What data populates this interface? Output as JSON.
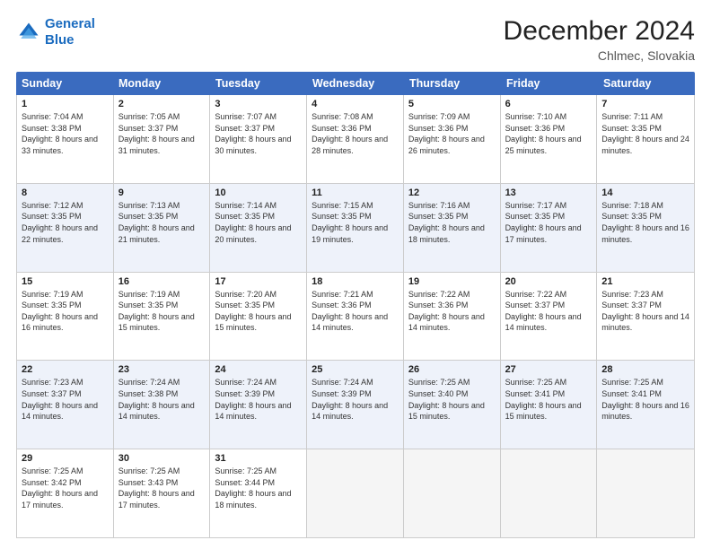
{
  "logo": {
    "line1": "General",
    "line2": "Blue"
  },
  "title": "December 2024",
  "location": "Chlmec, Slovakia",
  "header": {
    "days": [
      "Sunday",
      "Monday",
      "Tuesday",
      "Wednesday",
      "Thursday",
      "Friday",
      "Saturday"
    ]
  },
  "rows": [
    [
      {
        "day": "1",
        "sunrise": "7:04 AM",
        "sunset": "3:38 PM",
        "daylight": "8 hours and 33 minutes."
      },
      {
        "day": "2",
        "sunrise": "7:05 AM",
        "sunset": "3:37 PM",
        "daylight": "8 hours and 31 minutes."
      },
      {
        "day": "3",
        "sunrise": "7:07 AM",
        "sunset": "3:37 PM",
        "daylight": "8 hours and 30 minutes."
      },
      {
        "day": "4",
        "sunrise": "7:08 AM",
        "sunset": "3:36 PM",
        "daylight": "8 hours and 28 minutes."
      },
      {
        "day": "5",
        "sunrise": "7:09 AM",
        "sunset": "3:36 PM",
        "daylight": "8 hours and 26 minutes."
      },
      {
        "day": "6",
        "sunrise": "7:10 AM",
        "sunset": "3:36 PM",
        "daylight": "8 hours and 25 minutes."
      },
      {
        "day": "7",
        "sunrise": "7:11 AM",
        "sunset": "3:35 PM",
        "daylight": "8 hours and 24 minutes."
      }
    ],
    [
      {
        "day": "8",
        "sunrise": "7:12 AM",
        "sunset": "3:35 PM",
        "daylight": "8 hours and 22 minutes."
      },
      {
        "day": "9",
        "sunrise": "7:13 AM",
        "sunset": "3:35 PM",
        "daylight": "8 hours and 21 minutes."
      },
      {
        "day": "10",
        "sunrise": "7:14 AM",
        "sunset": "3:35 PM",
        "daylight": "8 hours and 20 minutes."
      },
      {
        "day": "11",
        "sunrise": "7:15 AM",
        "sunset": "3:35 PM",
        "daylight": "8 hours and 19 minutes."
      },
      {
        "day": "12",
        "sunrise": "7:16 AM",
        "sunset": "3:35 PM",
        "daylight": "8 hours and 18 minutes."
      },
      {
        "day": "13",
        "sunrise": "7:17 AM",
        "sunset": "3:35 PM",
        "daylight": "8 hours and 17 minutes."
      },
      {
        "day": "14",
        "sunrise": "7:18 AM",
        "sunset": "3:35 PM",
        "daylight": "8 hours and 16 minutes."
      }
    ],
    [
      {
        "day": "15",
        "sunrise": "7:19 AM",
        "sunset": "3:35 PM",
        "daylight": "8 hours and 16 minutes."
      },
      {
        "day": "16",
        "sunrise": "7:19 AM",
        "sunset": "3:35 PM",
        "daylight": "8 hours and 15 minutes."
      },
      {
        "day": "17",
        "sunrise": "7:20 AM",
        "sunset": "3:35 PM",
        "daylight": "8 hours and 15 minutes."
      },
      {
        "day": "18",
        "sunrise": "7:21 AM",
        "sunset": "3:36 PM",
        "daylight": "8 hours and 14 minutes."
      },
      {
        "day": "19",
        "sunrise": "7:22 AM",
        "sunset": "3:36 PM",
        "daylight": "8 hours and 14 minutes."
      },
      {
        "day": "20",
        "sunrise": "7:22 AM",
        "sunset": "3:37 PM",
        "daylight": "8 hours and 14 minutes."
      },
      {
        "day": "21",
        "sunrise": "7:23 AM",
        "sunset": "3:37 PM",
        "daylight": "8 hours and 14 minutes."
      }
    ],
    [
      {
        "day": "22",
        "sunrise": "7:23 AM",
        "sunset": "3:37 PM",
        "daylight": "8 hours and 14 minutes."
      },
      {
        "day": "23",
        "sunrise": "7:24 AM",
        "sunset": "3:38 PM",
        "daylight": "8 hours and 14 minutes."
      },
      {
        "day": "24",
        "sunrise": "7:24 AM",
        "sunset": "3:39 PM",
        "daylight": "8 hours and 14 minutes."
      },
      {
        "day": "25",
        "sunrise": "7:24 AM",
        "sunset": "3:39 PM",
        "daylight": "8 hours and 14 minutes."
      },
      {
        "day": "26",
        "sunrise": "7:25 AM",
        "sunset": "3:40 PM",
        "daylight": "8 hours and 15 minutes."
      },
      {
        "day": "27",
        "sunrise": "7:25 AM",
        "sunset": "3:41 PM",
        "daylight": "8 hours and 15 minutes."
      },
      {
        "day": "28",
        "sunrise": "7:25 AM",
        "sunset": "3:41 PM",
        "daylight": "8 hours and 16 minutes."
      }
    ],
    [
      {
        "day": "29",
        "sunrise": "7:25 AM",
        "sunset": "3:42 PM",
        "daylight": "8 hours and 17 minutes."
      },
      {
        "day": "30",
        "sunrise": "7:25 AM",
        "sunset": "3:43 PM",
        "daylight": "8 hours and 17 minutes."
      },
      {
        "day": "31",
        "sunrise": "7:25 AM",
        "sunset": "3:44 PM",
        "daylight": "8 hours and 18 minutes."
      },
      null,
      null,
      null,
      null
    ]
  ],
  "labels": {
    "sunrise": "Sunrise:",
    "sunset": "Sunset:",
    "daylight": "Daylight:"
  }
}
